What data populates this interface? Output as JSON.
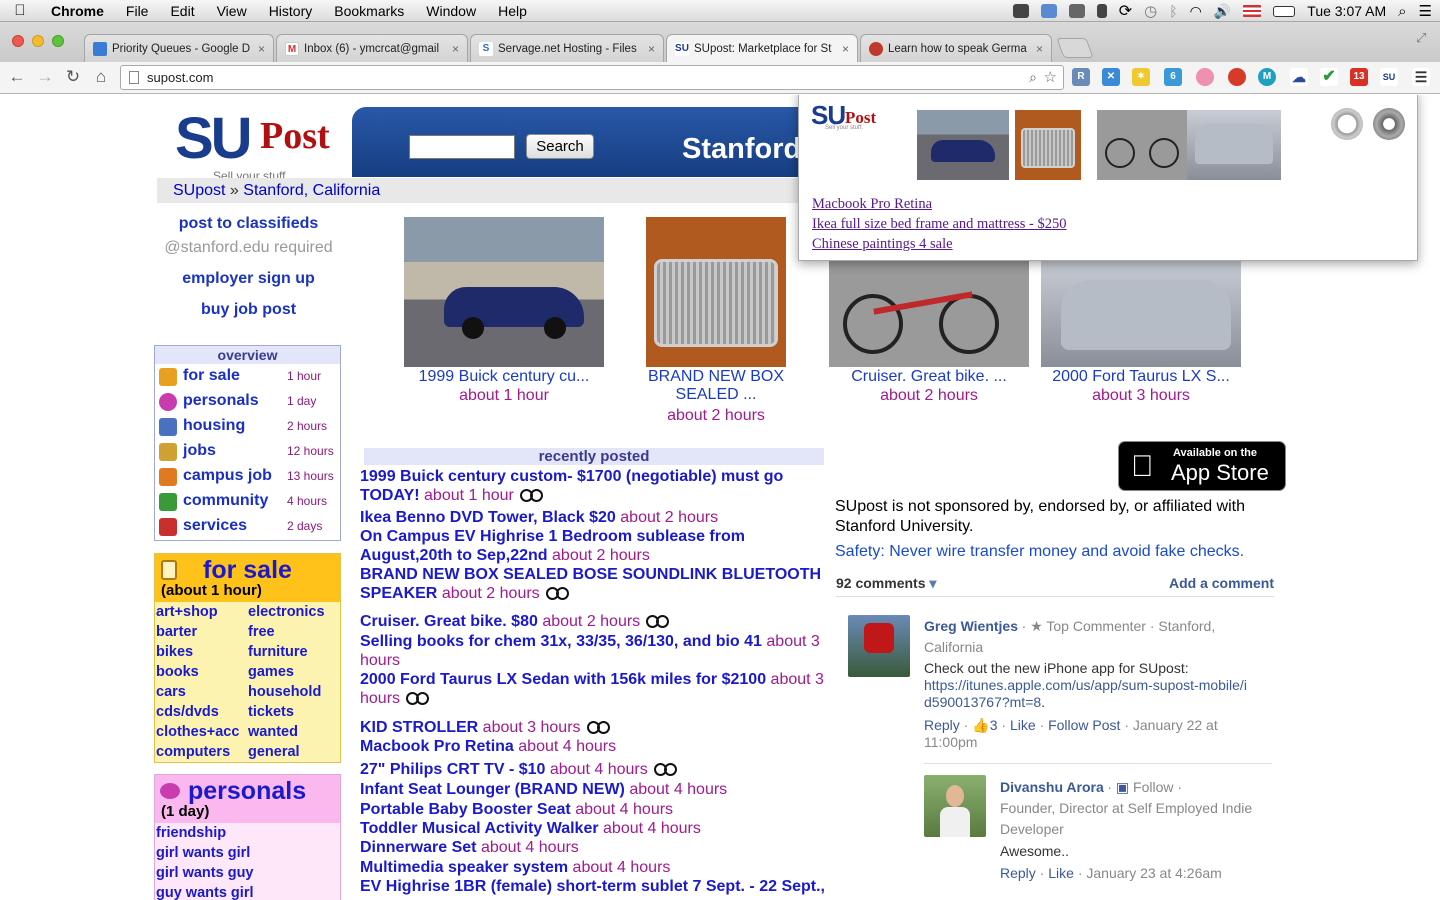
{
  "menubar": {
    "app": "Chrome",
    "items": [
      "File",
      "Edit",
      "View",
      "History",
      "Bookmarks",
      "Window",
      "Help"
    ],
    "clock": "Tue 3:07 AM"
  },
  "tabs": [
    {
      "label": "Priority Queues - Google D",
      "favicon": "docs-icon",
      "color": "#3a7bd5"
    },
    {
      "label": "Inbox (6) - ymcrcat@gmail",
      "favicon": "gmail-icon",
      "color": "#d93025"
    },
    {
      "label": "Servage.net Hosting - Files",
      "favicon": "servage-icon",
      "color": "#2a6fb0"
    },
    {
      "label": "SUpost: Marketplace for St",
      "favicon": "supost-icon",
      "color": "#1a3c8f"
    },
    {
      "label": "Learn how to speak Germa",
      "favicon": "lips-icon",
      "color": "#c0392b"
    }
  ],
  "url": "supost.com",
  "site": {
    "logo_su": "SU",
    "logo_post": "Post",
    "tagline": "Sell your stuff.",
    "search_button": "Search",
    "banner_title": "Stanford",
    "breadcrumb_home": "SUpost",
    "breadcrumb_sep": "»",
    "breadcrumb_loc": "Stanford, California"
  },
  "left": {
    "post_classifieds": "post to classifieds",
    "stanford_required": "@stanford.edu required",
    "employer_signup": "employer sign up",
    "buy_job_post": "buy job post",
    "overview_title": "overview",
    "overview": [
      {
        "label": "for sale",
        "time": "1 hour",
        "icon": "shopping-bag-icon",
        "color": "#e8a020"
      },
      {
        "label": "personals",
        "time": "1 day",
        "icon": "hearts-icon",
        "color": "#c83cb0"
      },
      {
        "label": "housing",
        "time": "2 hours",
        "icon": "building-icon",
        "color": "#4a70c0"
      },
      {
        "label": "jobs",
        "time": "12 hours",
        "icon": "briefcase-icon",
        "color": "#d0a030"
      },
      {
        "label": "campus job",
        "time": "13 hours",
        "icon": "handshake-icon",
        "color": "#e07a20"
      },
      {
        "label": "community",
        "time": "4 hours",
        "icon": "people-icon",
        "color": "#3a9a3a"
      },
      {
        "label": "services",
        "time": "2 days",
        "icon": "tools-icon",
        "color": "#c83030"
      }
    ],
    "forsale_title": "for sale",
    "forsale_sub": "(about 1 hour)",
    "forsale_cats": [
      [
        "art+shop",
        "electronics"
      ],
      [
        "barter",
        "free"
      ],
      [
        "bikes",
        "furniture"
      ],
      [
        "books",
        "games"
      ],
      [
        "cars",
        "household"
      ],
      [
        "cds/dvds",
        "tickets"
      ],
      [
        "clothes+acc",
        "wanted"
      ],
      [
        "computers",
        "general"
      ]
    ],
    "personals_title": "personals",
    "personals_sub": "(1 day)",
    "personals_cats": [
      "friendship",
      "girl wants girl",
      "girl wants guy",
      "guy wants girl"
    ]
  },
  "featured": [
    {
      "caption": "1999 Buick century cu...",
      "time": "about 1 hour",
      "img": "blue-sedan-photo"
    },
    {
      "caption": "BRAND NEW BOX SEALED ...",
      "time": "about 2 hours",
      "img": "bose-speaker-photo"
    },
    {
      "caption": "Cruiser. Great bike. ...",
      "time": "about 2 hours",
      "img": "bicycle-photo"
    },
    {
      "caption": "2000 Ford Taurus LX S...",
      "time": "about 3 hours",
      "img": "silver-sedan-photo"
    }
  ],
  "recent_title": "recently posted",
  "recent": [
    {
      "title": "1999 Buick century custom- $1700 (negotiable) must go TODAY!",
      "time": "about 1 hour",
      "photo": true
    },
    {
      "title": "Ikea Benno DVD Tower, Black $20",
      "time": "about 2 hours",
      "photo": false
    },
    {
      "title": "On Campus EV Highrise 1 Bedroom sublease from August,20th to Sep,22nd",
      "time": "about 2 hours",
      "photo": false
    },
    {
      "title": "BRAND NEW BOX SEALED BOSE SOUNDLINK BLUETOOTH SPEAKER",
      "time": "about 2 hours",
      "photo": true
    },
    {
      "title": "Cruiser. Great bike. $80",
      "time": "about 2 hours",
      "photo": true
    },
    {
      "title": "Selling books for chem 31x, 33/35, 36/130, and bio 41",
      "time": "about 3 hours",
      "photo": false
    },
    {
      "title": "2000 Ford Taurus LX Sedan with 156k miles for $2100",
      "time": "about 3 hours",
      "photo": true
    },
    {
      "title": "KID STROLLER",
      "time": "about 3 hours",
      "photo": true
    },
    {
      "title": "Macbook Pro Retina",
      "time": "about 4 hours",
      "photo": false
    },
    {
      "title": "27\" Philips CRT TV - $10",
      "time": "about 4 hours",
      "photo": true
    },
    {
      "title": "Infant Seat Lounger (BRAND NEW)",
      "time": "about 4 hours",
      "photo": false
    },
    {
      "title": "Portable Baby Booster Seat",
      "time": "about 4 hours",
      "photo": false
    },
    {
      "title": "Toddler Musical Activity Walker",
      "time": "about 4 hours",
      "photo": false
    },
    {
      "title": "Dinnerware Set",
      "time": "about 4 hours",
      "photo": false
    },
    {
      "title": "Multimedia speaker system",
      "time": "about 4 hours",
      "photo": false
    },
    {
      "title": "EV Highrise 1BR (female) short-term sublet 7 Sept. - 22 Sept.,",
      "time": "",
      "photo": false
    }
  ],
  "appstore": {
    "line1": "Available on the",
    "line2": "App Store"
  },
  "disclaimer": "SUpost is not sponsored by, endorsed by, or affiliated with Stanford University.",
  "safety": "Safety: Never wire transfer money and avoid fake checks.",
  "comments": {
    "count": "92 comments",
    "add": "Add a comment",
    "items": [
      {
        "name": "Greg Wientjes",
        "meta": "· ★ Top Commenter · Stanford, California",
        "text": "Check out the new iPhone app for SUpost:",
        "link": "https://itunes.apple.com/us/app/sum-supost-mobile/id590013767?mt=8",
        "tail": ".",
        "reply": "Reply",
        "likes": "3",
        "like": "Like",
        "follow": "Follow Post",
        "date": "January 22 at 11:00pm"
      },
      {
        "name": "Divanshu Arora",
        "meta": "Follow ·",
        "meta2": "Founder, Director at Self Employed Indie Developer",
        "text": "Awesome..",
        "reply": "Reply",
        "like": "Like",
        "date": "January 23 at 4:26am"
      }
    ]
  },
  "popup": {
    "links": [
      "Macbook Pro Retina",
      "Ikea full size bed frame and mattress - $250",
      "Chinese paintings 4 sale"
    ]
  }
}
